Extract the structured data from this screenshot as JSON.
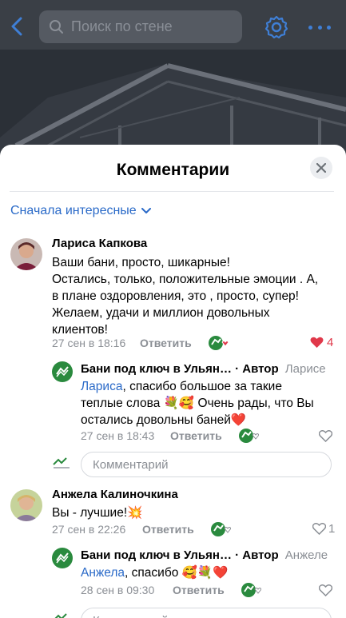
{
  "header": {
    "search_placeholder": "Поиск по стене",
    "colors": {
      "accent": "#3f7fd6"
    }
  },
  "sheet": {
    "title": "Комментарии",
    "sort_label": "Сначала интересные"
  },
  "comments": [
    {
      "author": "Лариса Капкова",
      "lines": [
        "Ваши бани, просто, шикарные!",
        "Остались, только, положительные эмоции . А,",
        "в плане оздоровления, это , просто, супер!",
        "Желаем, удачи и миллион довольных",
        "клиентов!"
      ],
      "date": "27 сен в 18:16",
      "reply_label": "Ответить",
      "likes": "4",
      "reply": {
        "author": "Бани под ключ в Ульян… · Автор",
        "addressee": "Ларисе",
        "mention": "Лариса",
        "line1_rest": ", спасибо большое за такие",
        "line2": "теплые слова 💐🥰 Очень рады, что Вы",
        "line3": "остались довольны баней❤️",
        "date": "27 сен в 18:43",
        "reply_label": "Ответить"
      }
    },
    {
      "author": "Анжела Калиночкина",
      "text": "Вы - лучшие!💥",
      "date": "27 сен в 22:26",
      "reply_label": "Ответить",
      "likes": "1",
      "reply": {
        "author": "Бани под ключ в Ульян… · Автор",
        "addressee": "Анжеле",
        "mention": "Анжела",
        "line1_rest": ", спасибо 🥰💐❤️",
        "date": "28 сен в 09:30",
        "reply_label": "Ответить"
      }
    }
  ],
  "comment_input_placeholder": "Комментарий"
}
